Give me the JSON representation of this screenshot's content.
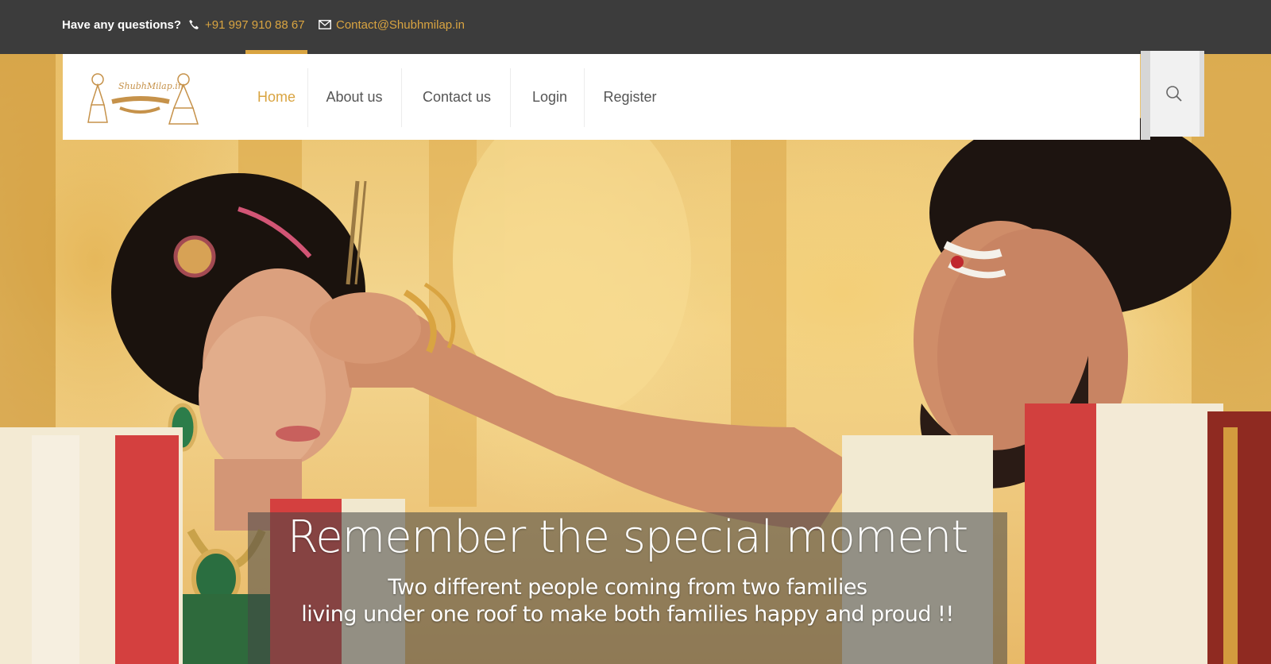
{
  "topbar": {
    "question": "Have any questions?",
    "phone": "+91 997 910 88 67",
    "email": "Contact@Shubhmilap.in",
    "phone_icon": "phone-icon",
    "email_icon": "mail-icon"
  },
  "brand": {
    "logo_text": "ShubhMilap.in"
  },
  "nav": {
    "items": [
      {
        "label": "Home",
        "active": true
      },
      {
        "label": "About us",
        "active": false
      },
      {
        "label": "Contact us",
        "active": false
      },
      {
        "label": "Login",
        "active": false
      },
      {
        "label": "Register",
        "active": false
      }
    ],
    "search_icon": "search-icon"
  },
  "hero": {
    "headline": "Remember the special moment",
    "subline1": "Two different people coming from two families",
    "subline2": "living under one roof to make both families happy and proud !!"
  },
  "colors": {
    "accent": "#d9a441",
    "topbar_bg": "#3c3c3c",
    "nav_text": "#555555"
  }
}
